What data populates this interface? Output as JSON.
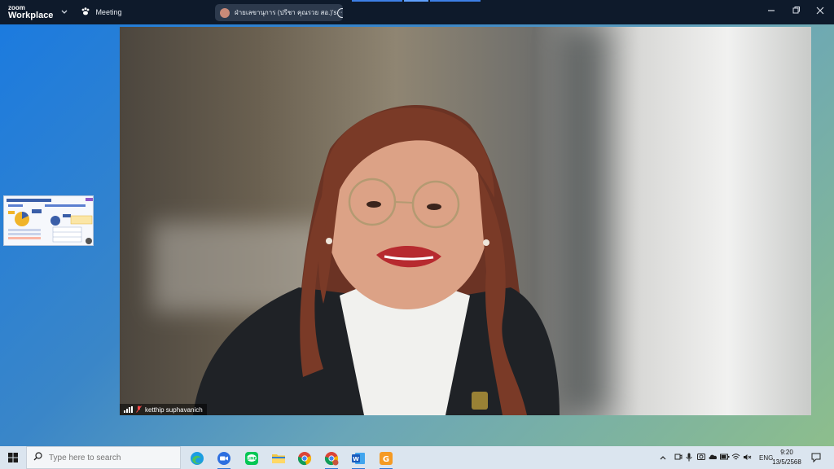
{
  "titlebar": {
    "brand_top": "zoom",
    "brand_bottom": "Workplace",
    "meeting_label": "Meeting",
    "share_label": "ฝ่ายเลขานุการ (ปรีชา คุณรวย สอ.)'s",
    "icons": [
      "chevron-down-icon",
      "paw-icon",
      "more-icon",
      "minimize-icon",
      "restore-icon",
      "close-icon"
    ]
  },
  "video": {
    "participant_name": "ketthip suphavanich",
    "mic_status": "muted"
  },
  "taskbar": {
    "search_placeholder": "Type here to search",
    "apps": [
      "edge",
      "zoom",
      "line",
      "file-explorer",
      "chrome",
      "chrome-profile",
      "word",
      "app-g"
    ],
    "tray": {
      "language": "ENG"
    },
    "clock": {
      "time": "9:20",
      "date": "13/5/2568"
    }
  },
  "colors": {
    "titlebar": "#0e1a2b",
    "taskbar": "#dbe5ef",
    "accent": "#2c74d8"
  }
}
